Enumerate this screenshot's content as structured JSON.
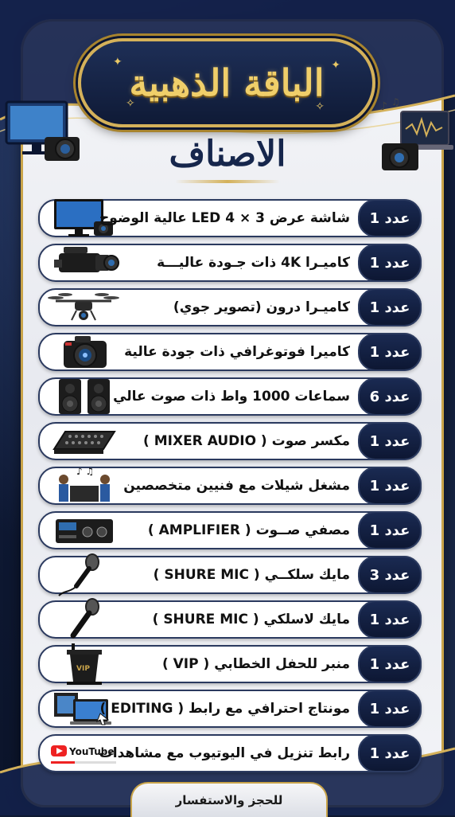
{
  "header": {
    "title": "الباقة الذهبية",
    "section_heading": "الاصناف"
  },
  "items": [
    {
      "label": "شاشة عرض 3 × 4 LED عالية الوضوح",
      "count": "عدد 1",
      "icon": "tv-screen-icon"
    },
    {
      "label": "كاميـرا 4K ذات جـودة عاليـــة",
      "count": "عدد 1",
      "icon": "video-camera-icon"
    },
    {
      "label": "كاميـرا درون (تصوير جوي)",
      "count": "عدد 1",
      "icon": "drone-icon"
    },
    {
      "label": "كاميرا فوتوغرافي ذات جودة عالية",
      "count": "عدد 1",
      "icon": "dslr-camera-icon"
    },
    {
      "label": "سماعات 1000 واط ذات صوت عالي",
      "count": "عدد 6",
      "icon": "speakers-icon"
    },
    {
      "label": "مكسر صوت ( MIXER AUDIO )",
      "count": "عدد 1",
      "icon": "audio-mixer-icon"
    },
    {
      "label": "مشغل شيلات مع فنيين متخصصين",
      "count": "عدد 1",
      "icon": "dj-technicians-icon"
    },
    {
      "label": "مصفي صــوت ( AMPLIFIER )",
      "count": "عدد 1",
      "icon": "amplifier-icon"
    },
    {
      "label": "مايك سلكــي ( SHURE MIC )",
      "count": "عدد 3",
      "icon": "wired-mic-icon"
    },
    {
      "label": "مايك لاسلكي ( SHURE MIC )",
      "count": "عدد 1",
      "icon": "wireless-mic-icon"
    },
    {
      "label": "منبر للحفل الخطابي ( VIP )",
      "count": "عدد 1",
      "icon": "podium-icon"
    },
    {
      "label": "مونتاج احترافي مع رابط ( EDITING )",
      "count": "عدد 1",
      "icon": "editing-laptop-icon"
    },
    {
      "label": "رابط تنزيل في اليوتيوب مع مشاهدات",
      "count": "عدد 1",
      "icon": "youtube-icon"
    }
  ],
  "podium_text": "VIP",
  "youtube_text": "YouTube",
  "footer": {
    "text": "للحجز والاستفسار"
  },
  "colors": {
    "navy": "#0d1733",
    "gold": "#d4b15a",
    "panel": "#f4f5f8"
  }
}
